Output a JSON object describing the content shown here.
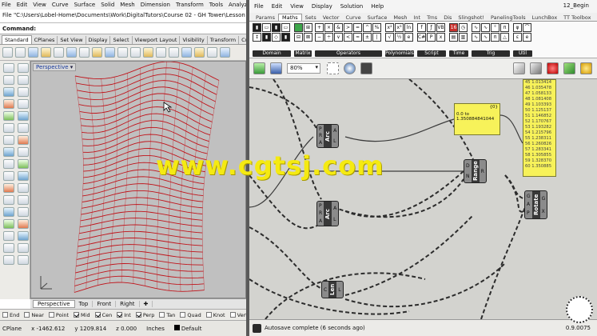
{
  "rhino": {
    "menu": [
      "File",
      "Edit",
      "View",
      "Curve",
      "Surface",
      "Solid",
      "Mesh",
      "Dimension",
      "Transform",
      "Tools",
      "Analyze"
    ],
    "file_path": "File \"C:\\Users\\Lobel-Home\\Documents\\Work\\DigitalTutors\\Course 02 - GH Tower\\Lesson 12\\1",
    "command_label": "Command:",
    "toolbar_tabs": [
      "Standard",
      "CPlanes",
      "Set View",
      "Display",
      "Select",
      "Viewport Layout",
      "Visibility",
      "Transform",
      "Cu"
    ],
    "viewport_title": "Perspective",
    "viewport_tabs": [
      "Perspective",
      "Top",
      "Front",
      "Right"
    ],
    "osnaps": [
      {
        "label": "End",
        "on": false
      },
      {
        "label": "Near",
        "on": false
      },
      {
        "label": "Point",
        "on": false
      },
      {
        "label": "Mid",
        "on": true
      },
      {
        "label": "Cen",
        "on": true
      },
      {
        "label": "Int",
        "on": true
      },
      {
        "label": "Perp",
        "on": true
      },
      {
        "label": "Tan",
        "on": false
      },
      {
        "label": "Quad",
        "on": false
      },
      {
        "label": "Knot",
        "on": false
      },
      {
        "label": "Vertex",
        "on": false
      }
    ],
    "status": {
      "cplane": "CPlane",
      "x": "x -1462.612",
      "y": "y 1209.814",
      "z": "z 0.000",
      "units": "Inches",
      "layer": "Default"
    },
    "curve_color": "#c0141b"
  },
  "gh": {
    "menu": [
      "File",
      "Edit",
      "View",
      "Display",
      "Solution",
      "Help"
    ],
    "title": "12_Begin",
    "tabs": [
      "Params",
      "Maths",
      "Sets",
      "Vector",
      "Curve",
      "Surface",
      "Mesh",
      "Int",
      "Trns",
      "Dis",
      "Slingshot!",
      "PanelingTools",
      "LunchBox",
      "TT Toolbox"
    ],
    "active_tab": "Maths",
    "groups": [
      "Domain",
      "Matrix",
      "Operators",
      "Polynomials",
      "Script",
      "Time",
      "Trig",
      "Util"
    ],
    "zoom": "80%",
    "panel_small": {
      "index": "{0}",
      "text": "0.0 to 1.350884841044"
    },
    "panel_values": [
      "45 1.013414",
      "46 1.035478",
      "47 1.058133",
      "48 1.081408",
      "49 1.103393",
      "50 1.125137",
      "51 1.146852",
      "52 1.170767",
      "53 1.193282",
      "54 1.215796",
      "55 1.238311",
      "56 1.260826",
      "57 1.283341",
      "58 1.305855",
      "59 1.328370",
      "60 1.350885"
    ],
    "components": [
      {
        "name": "Arc",
        "left_pins": [
          "P",
          "R",
          "A"
        ],
        "right_pins": [
          "A",
          "L"
        ]
      },
      {
        "name": "Range",
        "left_pins": [
          "D",
          "N"
        ],
        "right_pins": [
          "R"
        ]
      },
      {
        "name": "Rotate",
        "left_pins": [
          "G",
          "A",
          "P"
        ],
        "right_pins": [
          "G",
          "X"
        ]
      },
      {
        "name": "Arc",
        "left_pins": [
          "P",
          "R",
          "A"
        ],
        "right_pins": [
          "A",
          "L"
        ]
      },
      {
        "name": "Len",
        "left_pins": [
          "C"
        ],
        "right_pins": [
          "L"
        ]
      }
    ],
    "status": "Autosave complete (6 seconds ago)",
    "version": "0.9.0075"
  },
  "watermark": "www.cgtsj.com"
}
